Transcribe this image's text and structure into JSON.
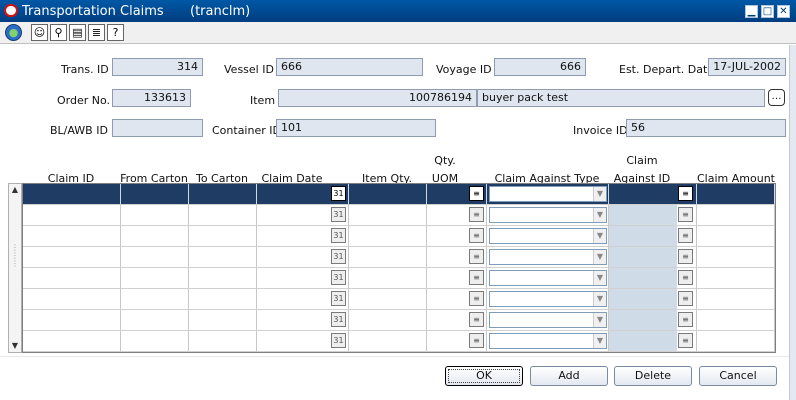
{
  "window": {
    "title": "Transportation Claims",
    "module": "(tranclm)"
  },
  "toolbar": {
    "icons": [
      "globe-icon",
      "face-icon",
      "find-icon",
      "notes-icon",
      "document-icon",
      "help-icon"
    ]
  },
  "header_fields": {
    "trans_id_label": "Trans. ID",
    "trans_id": "314",
    "vessel_id_label": "Vessel ID",
    "vessel_id": "666",
    "voyage_id_label": "Voyage ID",
    "voyage_id": "666",
    "est_depart_label": "Est. Depart. Date",
    "est_depart": "17-JUL-2002",
    "order_no_label": "Order No.",
    "order_no": "133613",
    "item_label": "Item",
    "item_id": "100786194",
    "item_desc": "buyer pack test",
    "bl_awb_label": "BL/AWB ID",
    "bl_awb": "",
    "container_label": "Container ID",
    "container": "101",
    "invoice_label": "Invoice ID",
    "invoice": "56"
  },
  "grid": {
    "columns": [
      {
        "line1": "",
        "line2": "Claim ID"
      },
      {
        "line1": "",
        "line2": "From Carton"
      },
      {
        "line1": "",
        "line2": "To Carton"
      },
      {
        "line1": "",
        "line2": "Claim Date"
      },
      {
        "line1": "",
        "line2": "Item Qty."
      },
      {
        "line1": "Qty.",
        "line2": "UOM"
      },
      {
        "line1": "",
        "line2": "Claim Against Type"
      },
      {
        "line1": "Claim",
        "line2": "Against ID"
      },
      {
        "line1": "",
        "line2": "Claim Amount"
      }
    ],
    "row_count": 8,
    "selected_row": 1
  },
  "buttons": {
    "ok": "OK",
    "add": "Add",
    "delete": "Delete",
    "cancel": "Cancel"
  }
}
